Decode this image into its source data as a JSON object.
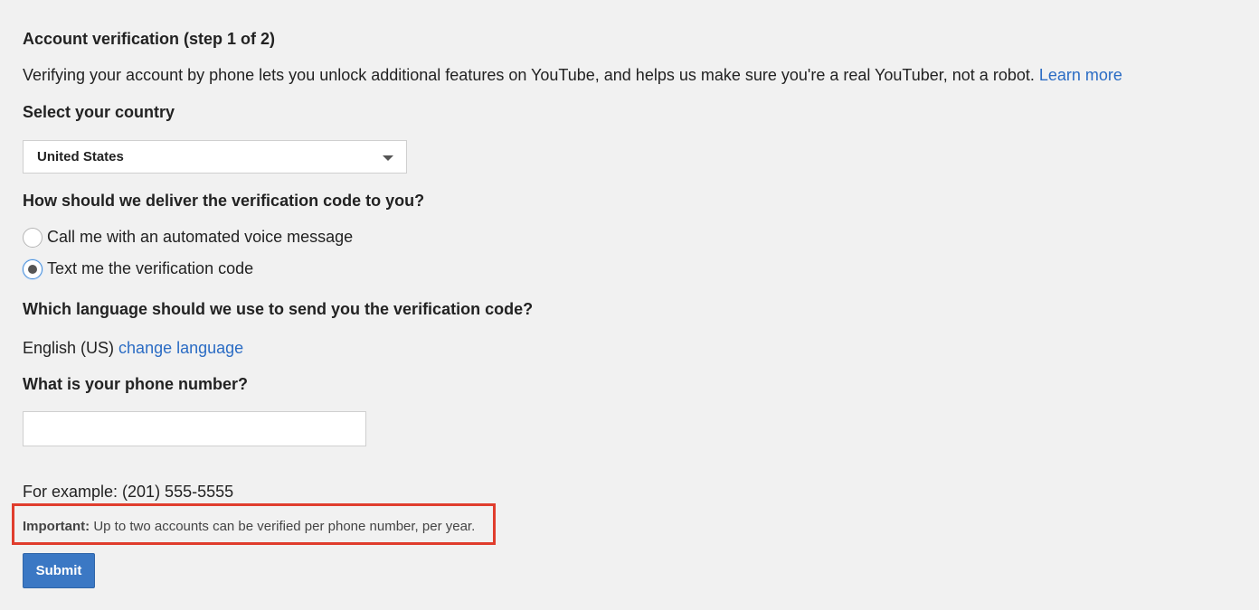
{
  "heading": "Account verification (step 1 of 2)",
  "intro": {
    "text": "Verifying your account by phone lets you unlock additional features on YouTube, and helps us make sure you're a real YouTuber, not a robot.",
    "learn_more": "Learn more"
  },
  "country": {
    "label": "Select your country",
    "selected": "United States"
  },
  "delivery": {
    "label": "How should we deliver the verification code to you?",
    "options": [
      {
        "label": "Call me with an automated voice message",
        "checked": false
      },
      {
        "label": "Text me the verification code",
        "checked": true
      }
    ]
  },
  "language": {
    "label": "Which language should we use to send you the verification code?",
    "current": "English (US)",
    "change_link": "change language"
  },
  "phone": {
    "label": "What is your phone number?",
    "value": "",
    "example": "For example: (201) 555-5555"
  },
  "notice": {
    "prefix": "Important:",
    "text": "Up to two accounts can be verified per phone number, per year.",
    "highlight_color": "#e03d2d"
  },
  "submit_label": "Submit",
  "colors": {
    "link": "#2b6cc4",
    "button": "#3b78c4",
    "background": "#f1f1f1"
  }
}
